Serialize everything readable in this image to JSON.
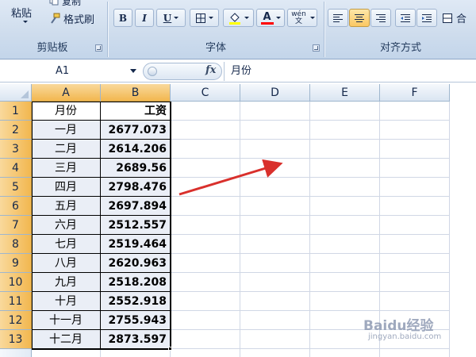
{
  "ribbon": {
    "clipboard": {
      "label": "剪贴板",
      "paste_label": "粘贴",
      "copy_label": "复制",
      "format_painter_label": "格式刷"
    },
    "font": {
      "label": "字体",
      "bold_icon": "B",
      "italic_icon": "I",
      "underline_icon": "U",
      "font_color_icon": "A",
      "phonetic_icon": "wén 文",
      "fill_color": "#ffff00",
      "font_color": "#ff0000"
    },
    "alignment": {
      "label": "对齐方式",
      "merge_label": "合"
    }
  },
  "formula_bar": {
    "name_box": "A1",
    "fx_label": "fx",
    "content": "月份"
  },
  "columns": [
    "A",
    "B",
    "C",
    "D",
    "E",
    "F"
  ],
  "rows": [
    {
      "num": "1",
      "a": "月份",
      "b": "工资"
    },
    {
      "num": "2",
      "a": "一月",
      "b": "2677.073"
    },
    {
      "num": "3",
      "a": "二月",
      "b": "2614.206"
    },
    {
      "num": "4",
      "a": "三月",
      "b": "2689.56"
    },
    {
      "num": "5",
      "a": "四月",
      "b": "2798.476"
    },
    {
      "num": "6",
      "a": "五月",
      "b": "2697.894"
    },
    {
      "num": "7",
      "a": "六月",
      "b": "2512.557"
    },
    {
      "num": "8",
      "a": "七月",
      "b": "2519.464"
    },
    {
      "num": "9",
      "a": "八月",
      "b": "2620.963"
    },
    {
      "num": "10",
      "a": "九月",
      "b": "2518.208"
    },
    {
      "num": "11",
      "a": "十月",
      "b": "2552.918"
    },
    {
      "num": "12",
      "a": "十一月",
      "b": "2755.943"
    },
    {
      "num": "13",
      "a": "十二月",
      "b": "2873.597"
    }
  ],
  "watermark": {
    "text": "Baidu经验",
    "sub": "jingyan.baidu.com"
  },
  "colors": {
    "annotation_arrow": "#d9302c",
    "selected_header": "#f2b74f",
    "ribbon_bg": "#cfdded"
  }
}
